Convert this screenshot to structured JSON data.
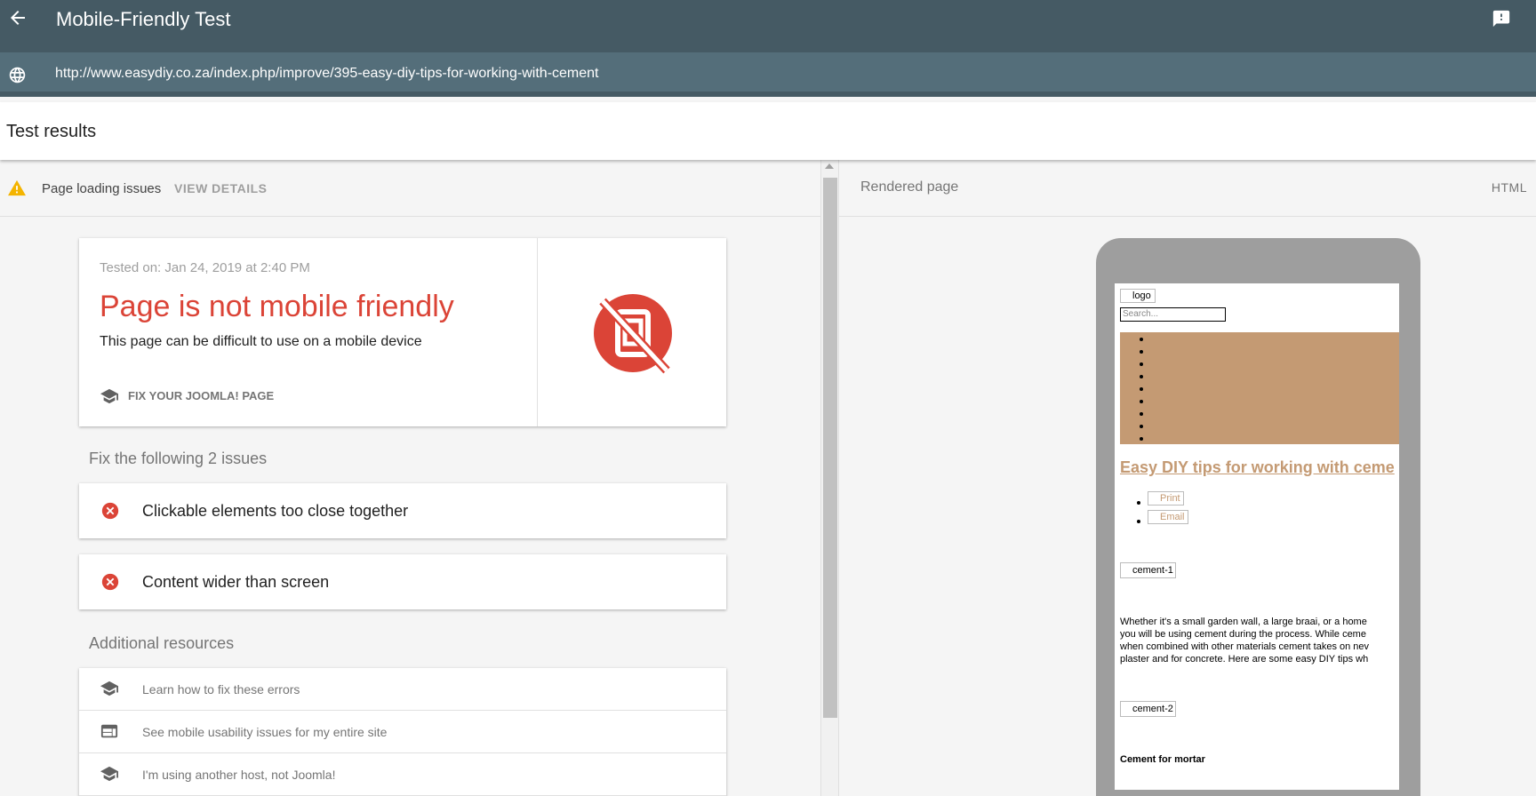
{
  "appbar": {
    "title": "Mobile-Friendly Test",
    "back_icon": "arrow-back-icon",
    "feedback_icon": "feedback-icon"
  },
  "urlbar": {
    "url": "http://www.easydiy.co.za/index.php/improve/395-easy-diy-tips-for-working-with-cement",
    "icon": "globe-icon"
  },
  "results": {
    "title": "Test results"
  },
  "loading": {
    "label": "Page loading issues",
    "view_details": "VIEW DETAILS"
  },
  "verdict": {
    "tested_on": "Tested on: Jan 24, 2019 at 2:40 PM",
    "headline": "Page is not mobile friendly",
    "subtext": "This page can be difficult to use on a mobile device",
    "fix_link": "FIX YOUR JOOMLA! PAGE",
    "color": "#db4437"
  },
  "issues": {
    "heading": "Fix the following 2 issues",
    "items": [
      {
        "label": "Clickable elements too close together"
      },
      {
        "label": "Content wider than screen"
      }
    ]
  },
  "resources": {
    "heading": "Additional resources",
    "items": [
      {
        "label": "Learn how to fix these errors",
        "icon": "school-icon"
      },
      {
        "label": "See mobile usability issues for my entire site",
        "icon": "web-icon"
      },
      {
        "label": "I'm using another host, not Joomla!",
        "icon": "school-icon"
      }
    ]
  },
  "rendered": {
    "label": "Rendered page",
    "html_tab": "HTML",
    "page": {
      "logo": "logo",
      "search_placeholder": "Search...",
      "nav_color": "#c49a73",
      "article_title": "Easy DIY tips for working with ceme",
      "print": "Print",
      "email": "Email",
      "img1": "cement-1",
      "img2": "cement-2",
      "paragraph": "Whether it's a small garden wall, a large braai, or a home\nyou will be using cement during the process. While ceme\nwhen combined with other materials cement takes on nev\nplaster and for concrete. Here are some easy DIY tips wh",
      "subheading": "Cement for mortar"
    }
  }
}
